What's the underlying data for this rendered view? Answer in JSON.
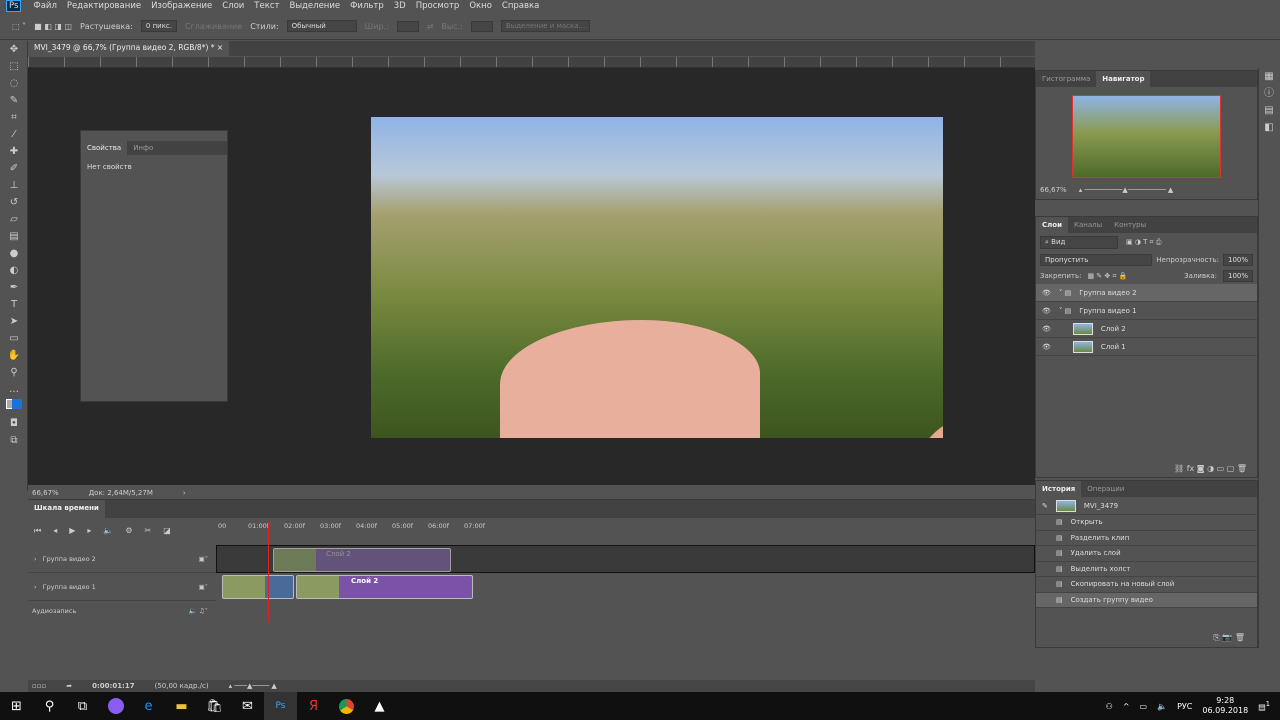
{
  "menu": {
    "logo": "Ps",
    "items": [
      "Файл",
      "Редактирование",
      "Изображение",
      "Слои",
      "Текст",
      "Выделение",
      "Фильтр",
      "3D",
      "Просмотр",
      "Окно",
      "Справка"
    ]
  },
  "options": {
    "feather_label": "Растушевка:",
    "feather_value": "0 пикс.",
    "antialias": "Сглаживание",
    "style_label": "Стили:",
    "style_value": "Обычный",
    "width_label": "Шир.:",
    "height_label": "Выс.:",
    "mask_button": "Выделение и маска..."
  },
  "document": {
    "tab": "MVI_3479 @ 66,7% (Группа видео 2, RGB/8*) *",
    "zoom": "66,67%",
    "doc_size": "Док: 2,64M/5,27M"
  },
  "properties": {
    "tabs": [
      "Свойства",
      "Инфо"
    ],
    "empty": "Нет свойств"
  },
  "navigator": {
    "tabs": [
      "Гистограмма",
      "Навигатор"
    ],
    "zoom": "66,67%"
  },
  "layers": {
    "tabs": [
      "Слои",
      "Каналы",
      "Контуры"
    ],
    "filter": "Вид",
    "blend": "Пропустить",
    "opacity_label": "Непрозрачность:",
    "opacity": "100%",
    "lock_label": "Закрепить:",
    "fill_label": "Заливка:",
    "fill": "100%",
    "items": [
      {
        "name": "Группа видео 2",
        "selected": true
      },
      {
        "name": "Группа видео 1"
      },
      {
        "name": "Слой 2"
      },
      {
        "name": "Слой 1"
      }
    ]
  },
  "history": {
    "tabs": [
      "История",
      "Операции"
    ],
    "snapshot": "MVI_3479",
    "items": [
      "Открыть",
      "Разделить клип",
      "Удалить слой",
      "Выделить холст",
      "Скопировать на новый слой",
      "Создать группу видео"
    ]
  },
  "timeline": {
    "title": "Шкала времени",
    "ticks": [
      "00",
      "01:00f",
      "02:00f",
      "03:00f",
      "04:00f",
      "05:00f",
      "06:00f",
      "07:00f"
    ],
    "tracks": [
      "Группа видео 2",
      "Группа видео 1",
      "Аудиозапись"
    ],
    "clip_label": "Слой 2",
    "time": "0:00:01:17",
    "fps": "(50,00 кадр./с)"
  },
  "taskbar": {
    "lang": "РУС",
    "time": "9:28",
    "date": "06.09.2018",
    "notifications": "1"
  }
}
